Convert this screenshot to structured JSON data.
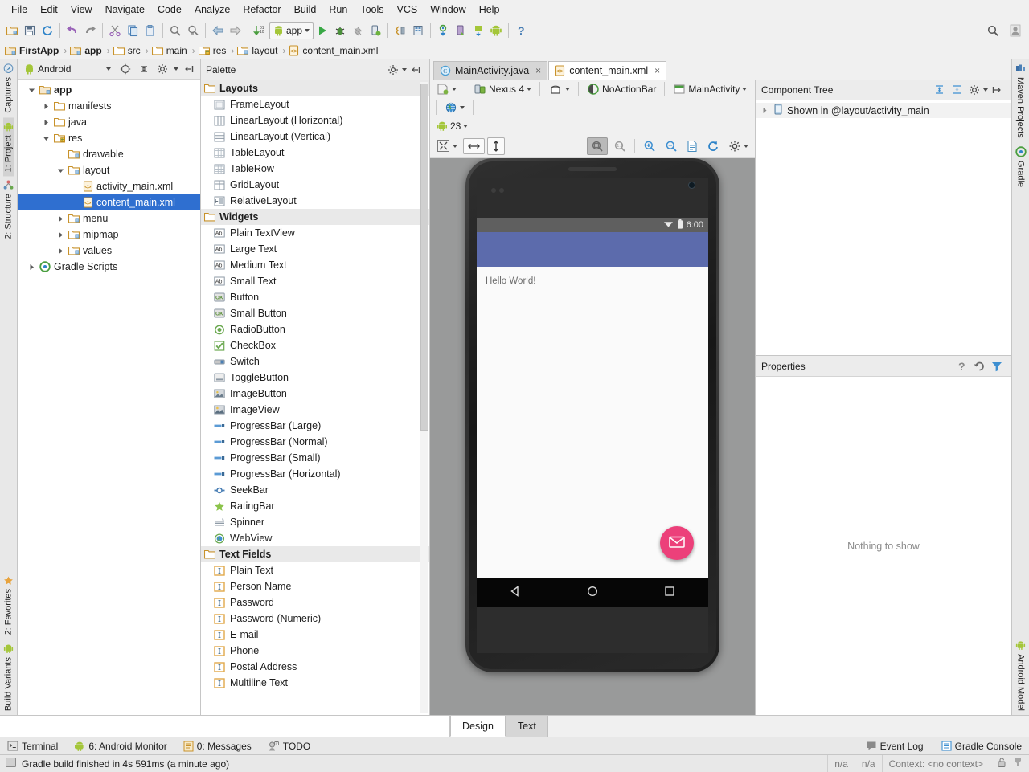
{
  "menubar": {
    "items": [
      "File",
      "Edit",
      "View",
      "Navigate",
      "Code",
      "Analyze",
      "Refactor",
      "Build",
      "Run",
      "Tools",
      "VCS",
      "Window",
      "Help"
    ]
  },
  "toolbar": {
    "run_config": "app",
    "icons": [
      "open-folder-icon",
      "save-all-icon",
      "sync-icon",
      "undo-icon",
      "redo-icon",
      "cut-icon",
      "copy-icon",
      "paste-icon",
      "find-icon",
      "find-replace-icon",
      "back-icon",
      "forward-icon",
      "run-anything-icon",
      "android-icon",
      "run-icon",
      "debug-icon",
      "coverage-icon",
      "attach-debugger-icon",
      "sdk-manager-icon",
      "avd-manager-icon",
      "sync-gradle-icon",
      "device-monitor-icon",
      "android-device-icon",
      "android-small-icon",
      "help-icon"
    ],
    "search_icon": "search-icon",
    "user_icon": "user-icon"
  },
  "breadcrumb": {
    "items": [
      {
        "label": "FirstApp",
        "icon": "module-icon",
        "bold": true
      },
      {
        "label": "app",
        "icon": "module-icon",
        "bold": true
      },
      {
        "label": "src",
        "icon": "folder-icon",
        "bold": false
      },
      {
        "label": "main",
        "icon": "folder-icon",
        "bold": false
      },
      {
        "label": "res",
        "icon": "res-folder-icon",
        "bold": false
      },
      {
        "label": "layout",
        "icon": "layout-folder-icon",
        "bold": false
      },
      {
        "label": "content_main.xml",
        "icon": "xml-file-icon",
        "bold": false
      }
    ]
  },
  "left_stripe": {
    "top": [
      {
        "label": "Captures",
        "icon": "captures-icon",
        "selected": false
      },
      {
        "label": "1: Project",
        "icon": "android-icon",
        "selected": true
      },
      {
        "label": "2: Structure",
        "icon": "structure-icon",
        "selected": false
      }
    ],
    "bottom": [
      {
        "label": "2: Favorites",
        "icon": "star-icon",
        "selected": false
      },
      {
        "label": "Build Variants",
        "icon": "android-icon",
        "selected": false
      }
    ]
  },
  "right_stripe": {
    "top": [
      {
        "label": "Maven Projects",
        "icon": "maven-icon",
        "selected": false
      },
      {
        "label": "Gradle",
        "icon": "gradle-icon",
        "selected": false
      }
    ],
    "bottom": [
      {
        "label": "Android Model",
        "icon": "android-icon",
        "selected": false
      }
    ]
  },
  "project_panel": {
    "view_selector": "Android",
    "header_icons": [
      "target-icon",
      "collapse-all-icon",
      "settings-gear-icon",
      "hide-icon"
    ],
    "tree": [
      {
        "label": "app",
        "indent": 0,
        "arrow": "down",
        "icon": "module-icon",
        "selected": false,
        "bold": true
      },
      {
        "label": "manifests",
        "indent": 1,
        "arrow": "right",
        "icon": "folder-icon",
        "selected": false,
        "bold": false
      },
      {
        "label": "java",
        "indent": 1,
        "arrow": "right",
        "icon": "folder-icon",
        "selected": false,
        "bold": false
      },
      {
        "label": "res",
        "indent": 1,
        "arrow": "down",
        "icon": "res-folder-icon",
        "selected": false,
        "bold": false
      },
      {
        "label": "drawable",
        "indent": 2,
        "arrow": "none",
        "icon": "layout-folder-icon",
        "selected": false,
        "bold": false
      },
      {
        "label": "layout",
        "indent": 2,
        "arrow": "down",
        "icon": "layout-folder-icon",
        "selected": false,
        "bold": false
      },
      {
        "label": "activity_main.xml",
        "indent": 3,
        "arrow": "none",
        "icon": "xml-file-icon",
        "selected": false,
        "bold": false
      },
      {
        "label": "content_main.xml",
        "indent": 3,
        "arrow": "none",
        "icon": "xml-file-icon",
        "selected": true,
        "bold": false
      },
      {
        "label": "menu",
        "indent": 2,
        "arrow": "right",
        "icon": "layout-folder-icon",
        "selected": false,
        "bold": false
      },
      {
        "label": "mipmap",
        "indent": 2,
        "arrow": "right",
        "icon": "layout-folder-icon",
        "selected": false,
        "bold": false
      },
      {
        "label": "values",
        "indent": 2,
        "arrow": "right",
        "icon": "layout-folder-icon",
        "selected": false,
        "bold": false
      },
      {
        "label": "Gradle Scripts",
        "indent": 0,
        "arrow": "right",
        "icon": "gradle-icon",
        "selected": false,
        "bold": false
      }
    ]
  },
  "editor_tabs": [
    {
      "label": "MainActivity.java",
      "icon": "java-class-icon",
      "active": false,
      "close": "×"
    },
    {
      "label": "content_main.xml",
      "icon": "xml-file-icon",
      "active": true,
      "close": "×"
    }
  ],
  "palette": {
    "title": "Palette",
    "header_icons": [
      "settings-gear-icon",
      "hide-icon"
    ],
    "groups": [
      {
        "name": "Layouts",
        "items": [
          {
            "label": "FrameLayout",
            "icon": "frame-layout-icon"
          },
          {
            "label": "LinearLayout (Horizontal)",
            "icon": "linear-layout-horizontal-icon"
          },
          {
            "label": "LinearLayout (Vertical)",
            "icon": "linear-layout-vertical-icon"
          },
          {
            "label": "TableLayout",
            "icon": "table-layout-icon"
          },
          {
            "label": "TableRow",
            "icon": "table-row-icon"
          },
          {
            "label": "GridLayout",
            "icon": "grid-layout-icon"
          },
          {
            "label": "RelativeLayout",
            "icon": "relative-layout-icon"
          }
        ]
      },
      {
        "name": "Widgets",
        "items": [
          {
            "label": "Plain TextView",
            "icon": "textview-icon"
          },
          {
            "label": "Large Text",
            "icon": "textview-icon"
          },
          {
            "label": "Medium Text",
            "icon": "textview-icon"
          },
          {
            "label": "Small Text",
            "icon": "textview-icon"
          },
          {
            "label": "Button",
            "icon": "button-icon"
          },
          {
            "label": "Small Button",
            "icon": "button-icon"
          },
          {
            "label": "RadioButton",
            "icon": "radio-button-icon"
          },
          {
            "label": "CheckBox",
            "icon": "checkbox-icon"
          },
          {
            "label": "Switch",
            "icon": "switch-icon"
          },
          {
            "label": "ToggleButton",
            "icon": "toggle-button-icon"
          },
          {
            "label": "ImageButton",
            "icon": "image-button-icon"
          },
          {
            "label": "ImageView",
            "icon": "imageview-icon"
          },
          {
            "label": "ProgressBar (Large)",
            "icon": "progressbar-icon"
          },
          {
            "label": "ProgressBar (Normal)",
            "icon": "progressbar-icon"
          },
          {
            "label": "ProgressBar (Small)",
            "icon": "progressbar-icon"
          },
          {
            "label": "ProgressBar (Horizontal)",
            "icon": "progressbar-icon"
          },
          {
            "label": "SeekBar",
            "icon": "seekbar-icon"
          },
          {
            "label": "RatingBar",
            "icon": "ratingbar-icon"
          },
          {
            "label": "Spinner",
            "icon": "spinner-icon"
          },
          {
            "label": "WebView",
            "icon": "webview-icon"
          }
        ]
      },
      {
        "name": "Text Fields",
        "items": [
          {
            "label": "Plain Text",
            "icon": "textfield-icon"
          },
          {
            "label": "Person Name",
            "icon": "textfield-icon"
          },
          {
            "label": "Password",
            "icon": "textfield-icon"
          },
          {
            "label": "Password (Numeric)",
            "icon": "textfield-icon"
          },
          {
            "label": "E-mail",
            "icon": "textfield-icon"
          },
          {
            "label": "Phone",
            "icon": "textfield-icon"
          },
          {
            "label": "Postal Address",
            "icon": "textfield-icon"
          },
          {
            "label": "Multiline Text",
            "icon": "textfield-icon"
          }
        ]
      }
    ]
  },
  "design_toolbar": {
    "row1": [
      {
        "label": "",
        "icon": "device-config-icon",
        "caret": true
      },
      {
        "label": "Nexus 4",
        "icon": "device-icon",
        "caret": true
      },
      {
        "label": "",
        "icon": "orientation-icon",
        "caret": true
      },
      {
        "label": "NoActionBar",
        "icon": "theme-icon",
        "caret": false
      },
      {
        "label": "MainActivity",
        "icon": "activity-icon",
        "caret": true
      },
      {
        "label": "",
        "icon": "locale-globe-icon",
        "caret": true
      }
    ],
    "row2": [
      {
        "label": "23",
        "icon": "android-icon",
        "caret": true
      }
    ],
    "row3_left": [
      {
        "label": "",
        "icon": "fit-screen-icon",
        "caret": true
      },
      {
        "label": "",
        "icon": "width-icon",
        "caret": false
      },
      {
        "label": "",
        "icon": "height-icon",
        "caret": false
      }
    ],
    "row3_right": [
      {
        "label": "",
        "icon": "zoom-to-fit-icon",
        "pressed": true
      },
      {
        "label": "",
        "icon": "zoom-actual-icon",
        "pressed": false
      },
      {
        "label": "",
        "icon": "zoom-in-icon",
        "pressed": false
      },
      {
        "label": "",
        "icon": "zoom-out-icon",
        "pressed": false
      },
      {
        "label": "",
        "icon": "render-doc-icon",
        "pressed": false
      },
      {
        "label": "",
        "icon": "refresh-icon",
        "pressed": false
      },
      {
        "label": "",
        "icon": "settings-gear-icon",
        "pressed": false
      }
    ]
  },
  "preview": {
    "status_time": "6:00",
    "wifi_icon": "wifi-icon",
    "battery_icon": "battery-icon",
    "hello_text": "Hello World!",
    "fab_icon": "email-icon",
    "fab_color": "#ec407a",
    "appbar_color": "#5c6bac",
    "nav_back_icon": "nav-back-icon",
    "nav_home_icon": "nav-home-icon",
    "nav_recents_icon": "nav-recents-icon"
  },
  "component_tree": {
    "title": "Component Tree",
    "header_icons": [
      "expand-all-icon",
      "collapse-all-icon",
      "settings-gear-icon",
      "hide-icon"
    ],
    "rows": [
      {
        "label": "Shown in @layout/activity_main",
        "icon": "device-screen-icon",
        "arrow": "right"
      }
    ]
  },
  "properties": {
    "title": "Properties",
    "header_icons": [
      "help-icon",
      "restore-icon",
      "filter-icon"
    ],
    "empty_text": "Nothing to show"
  },
  "design_text_tabs": [
    {
      "label": "Design",
      "active": true
    },
    {
      "label": "Text",
      "active": false
    }
  ],
  "tool_windows": {
    "left": [
      {
        "label": "Terminal",
        "icon": "terminal-icon",
        "mnemonic": ""
      },
      {
        "label": "6: Android Monitor",
        "icon": "android-icon",
        "mnemonic": "6"
      },
      {
        "label": "0: Messages",
        "icon": "messages-icon",
        "mnemonic": "0"
      },
      {
        "label": "TODO",
        "icon": "todo-icon",
        "mnemonic": ""
      }
    ],
    "right": [
      {
        "label": "Event Log",
        "icon": "event-log-icon"
      },
      {
        "label": "Gradle Console",
        "icon": "gradle-console-icon"
      }
    ]
  },
  "statusbar": {
    "message": "Gradle build finished in 4s 591ms (a minute ago)",
    "message_icon": "build-icon",
    "cells": [
      "n/a",
      "n/a"
    ],
    "context": "Context: <no context>",
    "icons": [
      "lock-icon",
      "memory-icon"
    ]
  }
}
